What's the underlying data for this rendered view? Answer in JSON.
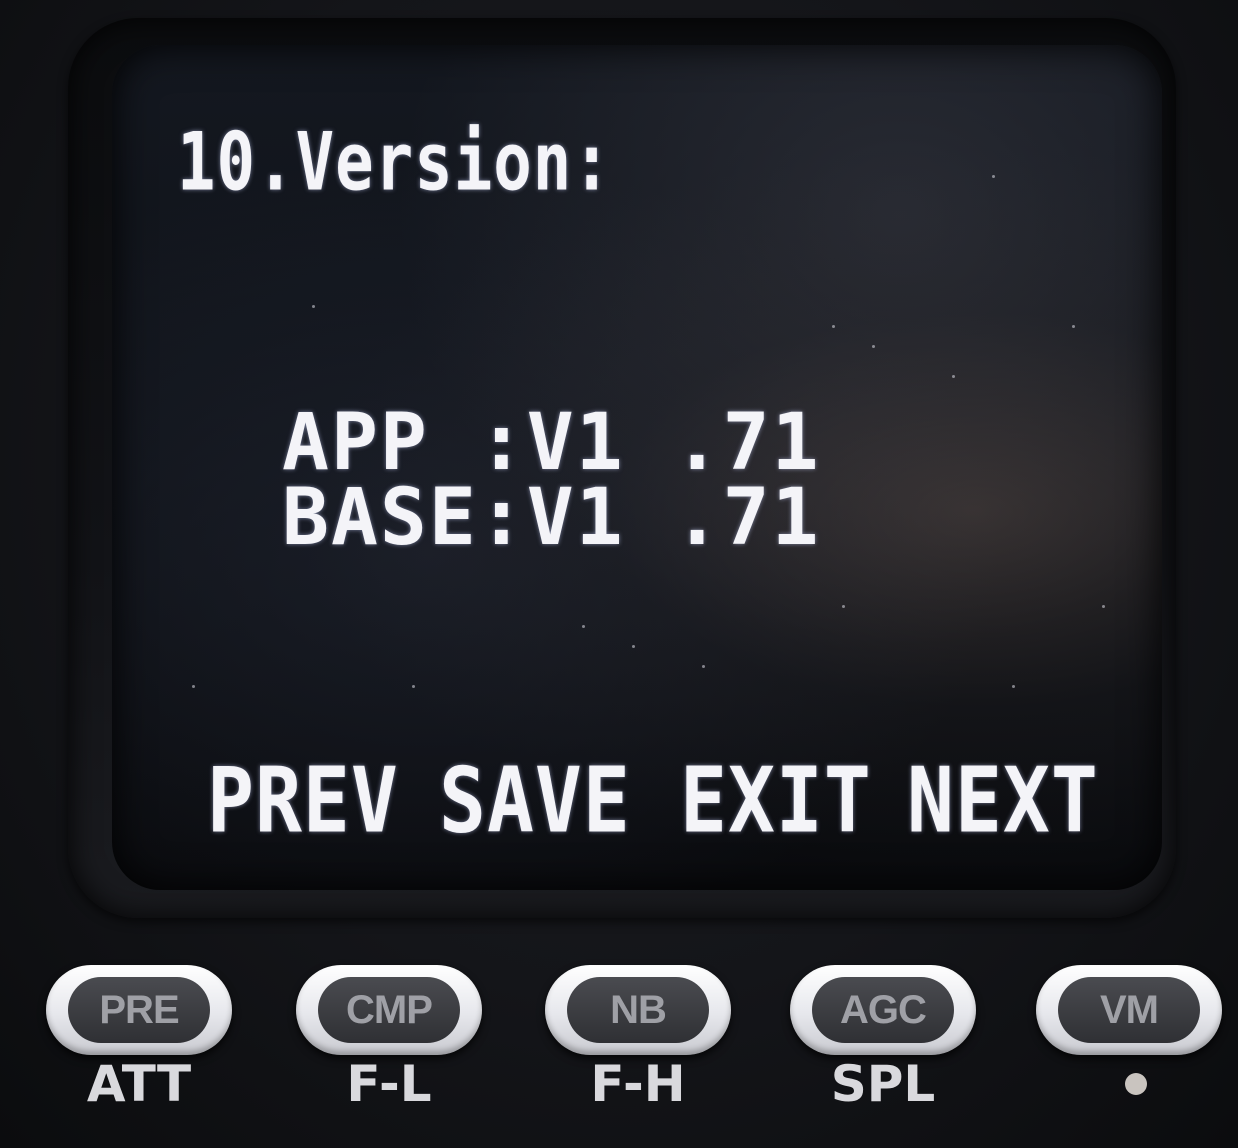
{
  "screen": {
    "title": "10.Version:",
    "app_line": "APP :V1 .71",
    "base_line": "BASE:V1 .71",
    "softkeys": [
      "PREV",
      "SAVE",
      "EXIT",
      "NEXT"
    ]
  },
  "buttons": [
    {
      "label": "PRE",
      "sub": "ATT"
    },
    {
      "label": "CMP",
      "sub": "F-L"
    },
    {
      "label": "NB",
      "sub": "F-H"
    },
    {
      "label": "AGC",
      "sub": "SPL"
    },
    {
      "label": "VM",
      "sub": ""
    }
  ],
  "colors": {
    "lcd_text": "#f4f4f8",
    "button_face": "#ffffff",
    "button_inner": "#3a3b40"
  }
}
